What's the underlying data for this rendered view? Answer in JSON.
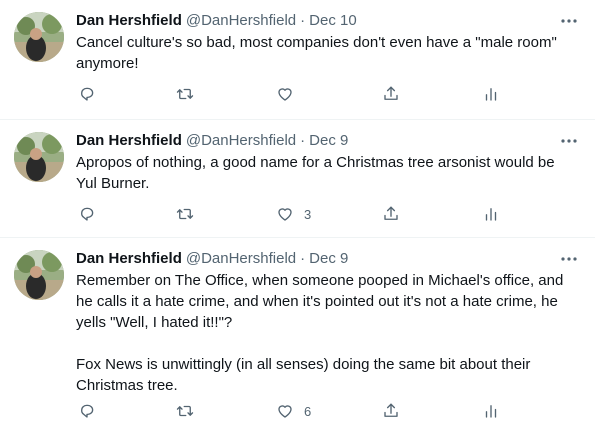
{
  "tweets": [
    {
      "name": "Dan Hershfield",
      "handle": "@DanHershfield",
      "separator": "·",
      "date": "Dec 10",
      "text": "Cancel culture's so bad, most companies don't even have a \"male room\" anymore!",
      "likes": ""
    },
    {
      "name": "Dan Hershfield",
      "handle": "@DanHershfield",
      "separator": "·",
      "date": "Dec 9",
      "text": "Apropos of nothing, a good name for a Christmas tree arsonist would be Yul Burner.",
      "likes": "3"
    },
    {
      "name": "Dan Hershfield",
      "handle": "@DanHershfield",
      "separator": "·",
      "date": "Dec 9",
      "text": "Remember on The Office, when someone pooped in Michael's office, and he calls it a hate crime, and when it's pointed out it's not a hate crime, he yells \"Well, I hated it!!\"?\n\nFox News is unwittingly (in all senses) doing the same bit about their Christmas tree.",
      "likes": "6"
    }
  ],
  "icons": {
    "reply": "reply-icon",
    "retweet": "retweet-icon",
    "like": "heart-icon",
    "share": "share-icon",
    "analytics": "analytics-icon",
    "more": "more-icon"
  },
  "colors": {
    "text": "#0f1419",
    "secondary": "#536471",
    "divider": "#eff3f4"
  }
}
